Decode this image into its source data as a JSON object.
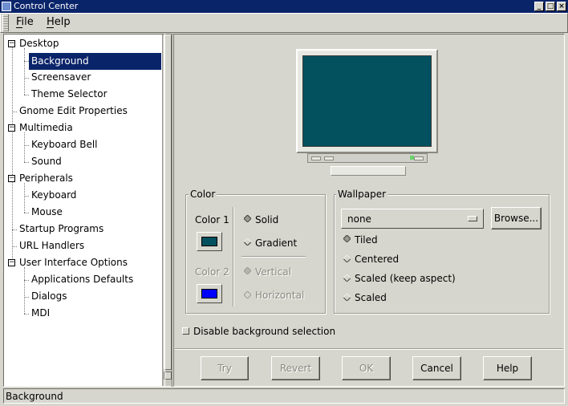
{
  "window": {
    "title": "Control Center",
    "controls": [
      "minimize-icon",
      "maximize-icon",
      "close-icon"
    ]
  },
  "menubar": {
    "file": "File",
    "help": "Help"
  },
  "tree": {
    "items": [
      {
        "label": "Desktop",
        "level": 0,
        "expander": "minus"
      },
      {
        "label": "Background",
        "level": 1,
        "selected": true
      },
      {
        "label": "Screensaver",
        "level": 1
      },
      {
        "label": "Theme Selector",
        "level": 1
      },
      {
        "label": "Gnome Edit Properties",
        "level": 0
      },
      {
        "label": "Multimedia",
        "level": 0,
        "expander": "minus"
      },
      {
        "label": "Keyboard Bell",
        "level": 1
      },
      {
        "label": "Sound",
        "level": 1
      },
      {
        "label": "Peripherals",
        "level": 0,
        "expander": "minus"
      },
      {
        "label": "Keyboard",
        "level": 1
      },
      {
        "label": "Mouse",
        "level": 1
      },
      {
        "label": "Startup Programs",
        "level": 0
      },
      {
        "label": "URL Handlers",
        "level": 0
      },
      {
        "label": "User Interface Options",
        "level": 0,
        "expander": "minus"
      },
      {
        "label": "Applications Defaults",
        "level": 1
      },
      {
        "label": "Dialogs",
        "level": 1
      },
      {
        "label": "MDI",
        "level": 1
      }
    ],
    "selected_color": "#0a246a"
  },
  "preview": {
    "screen_color": "#03505e"
  },
  "color_frame": {
    "label": "Color",
    "color1_label": "Color 1",
    "color1_value": "#03505e",
    "color2_label": "Color 2",
    "color2_value": "#0000ff",
    "solid_label": "Solid",
    "gradient_label": "Gradient",
    "vertical_label": "Vertical",
    "horizontal_label": "Horizontal",
    "selected_type": "Solid"
  },
  "wallpaper_frame": {
    "label": "Wallpaper",
    "selected_file": "none",
    "browse_label": "Browse...",
    "tiled_label": "Tiled",
    "centered_label": "Centered",
    "scaled_aspect_label": "Scaled (keep aspect)",
    "scaled_label": "Scaled",
    "selected_mode": "Tiled"
  },
  "disable_checkbox": {
    "label": "Disable background selection",
    "checked": false
  },
  "buttons": {
    "try": "Try",
    "revert": "Revert",
    "ok": "OK",
    "cancel": "Cancel",
    "help": "Help"
  },
  "status": {
    "text": "Background"
  }
}
